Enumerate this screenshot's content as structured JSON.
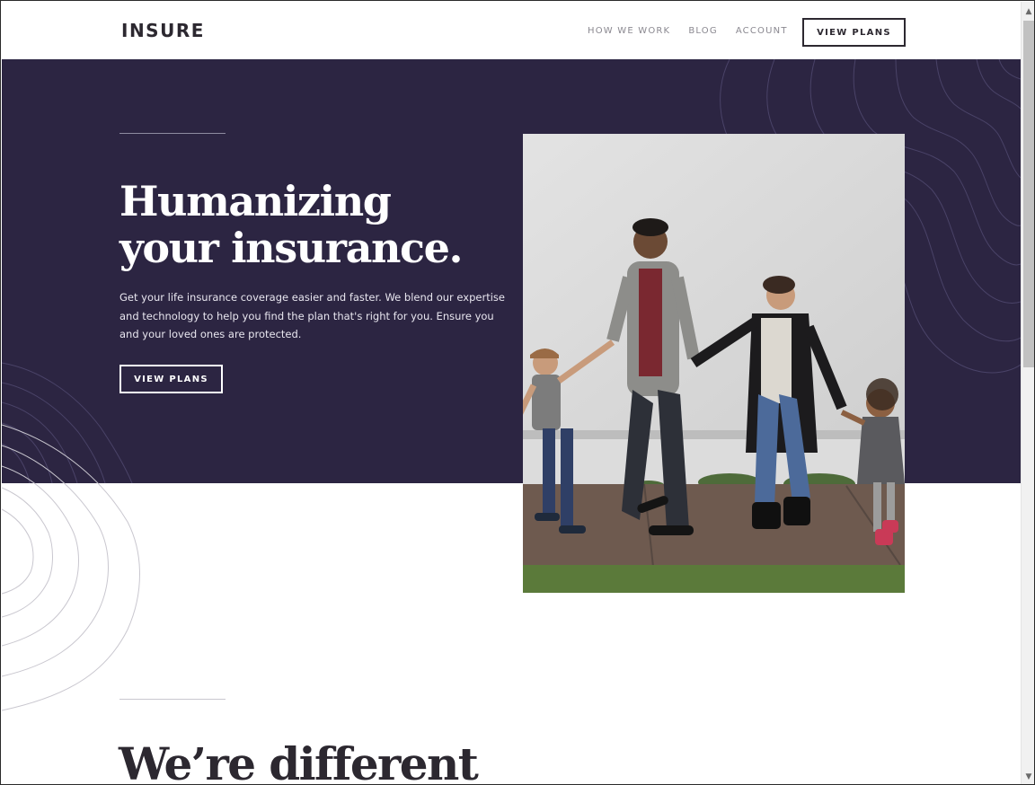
{
  "header": {
    "logo": "INSURE",
    "nav": [
      "HOW WE WORK",
      "BLOG",
      "ACCOUNT"
    ],
    "cta_label": "VIEW PLANS"
  },
  "hero": {
    "title_line1": "Humanizing",
    "title_line2": "your insurance.",
    "description": "Get your life insurance coverage easier and faster. We blend our expertise and technology to help you find the plan that's right for you. Ensure you and your loved ones are protected.",
    "cta_label": "VIEW PLANS"
  },
  "section": {
    "title": "We’re different"
  },
  "scrollbar": {
    "up_arrow_icon": "scroll-up-arrow",
    "down_arrow_icon": "scroll-down-arrow"
  },
  "colors": {
    "hero_bg": "#2c2542",
    "text_dark": "#2c2830",
    "nav_gray": "#8a8890",
    "pattern_stroke": "#5a5478"
  }
}
